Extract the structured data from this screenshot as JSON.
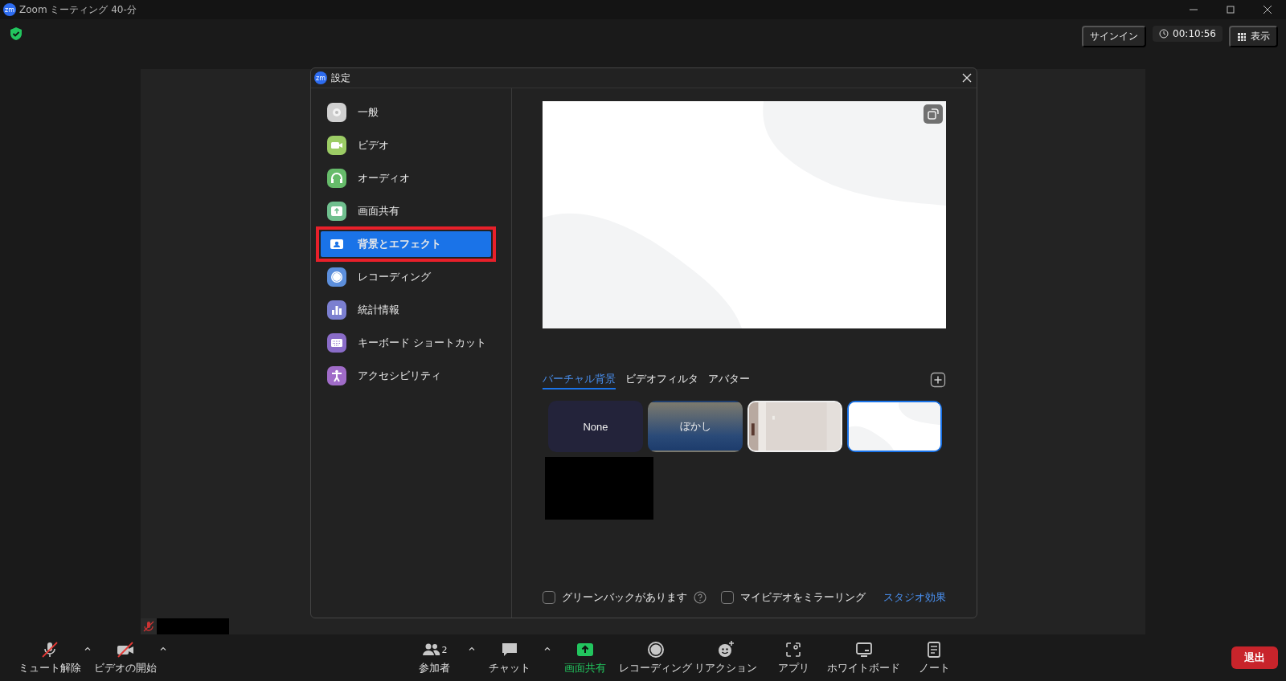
{
  "window": {
    "logo": "zm",
    "title": "Zoom ミーティング 40-分"
  },
  "top_bar": {
    "sign_in": "サインイン",
    "timer": "00:10:56",
    "view": "表示"
  },
  "settings": {
    "logo": "zm",
    "title": "設定",
    "sidebar": [
      {
        "label": "一般",
        "selected": false,
        "highlighted": false
      },
      {
        "label": "ビデオ",
        "selected": false,
        "highlighted": false
      },
      {
        "label": "オーディオ",
        "selected": false,
        "highlighted": false
      },
      {
        "label": "画面共有",
        "selected": false,
        "highlighted": false
      },
      {
        "label": "背景とエフェクト",
        "selected": true,
        "highlighted": true
      },
      {
        "label": "レコーディング",
        "selected": false,
        "highlighted": false
      },
      {
        "label": "統計情報",
        "selected": false,
        "highlighted": false
      },
      {
        "label": "キーボード ショートカット",
        "selected": false,
        "highlighted": false
      },
      {
        "label": "アクセシビリティ",
        "selected": false,
        "highlighted": false
      }
    ],
    "tabs": [
      {
        "label": "バーチャル背景",
        "selected": true
      },
      {
        "label": "ビデオフィルタ",
        "selected": false
      },
      {
        "label": "アバター",
        "selected": false
      }
    ],
    "backgrounds": [
      {
        "kind": "none",
        "label": "None",
        "selected": false
      },
      {
        "kind": "blur",
        "label": "ぼかし",
        "selected": false
      },
      {
        "kind": "picture",
        "selected": false
      },
      {
        "kind": "pattern",
        "selected": true
      }
    ],
    "options": [
      {
        "label": "グリーンバックがあります",
        "checked": false,
        "help": true
      },
      {
        "label": "マイビデオをミラーリング",
        "checked": false,
        "help": false
      }
    ],
    "studio_link": "スタジオ効果"
  },
  "toolbar": [
    {
      "label": "ミュート解除",
      "muted": true,
      "menu": true,
      "active": false
    },
    {
      "label": "ビデオの開始",
      "muted": true,
      "menu": true,
      "active": false
    },
    {
      "label": "参加者",
      "count": "2",
      "muted": false,
      "menu": true,
      "active": false
    },
    {
      "label": "チャット",
      "muted": false,
      "menu": true,
      "active": false
    },
    {
      "label": "画面共有",
      "muted": false,
      "menu": false,
      "active": true
    },
    {
      "label": "レコーディング",
      "muted": false,
      "menu": false,
      "active": false
    },
    {
      "label": "リアクション",
      "muted": false,
      "menu": false,
      "active": false
    },
    {
      "label": "アプリ",
      "muted": false,
      "menu": false,
      "active": false
    },
    {
      "label": "ホワイトボード",
      "muted": false,
      "menu": false,
      "active": false
    },
    {
      "label": "ノート",
      "muted": false,
      "menu": false,
      "active": false
    }
  ],
  "leave_button": "退出"
}
